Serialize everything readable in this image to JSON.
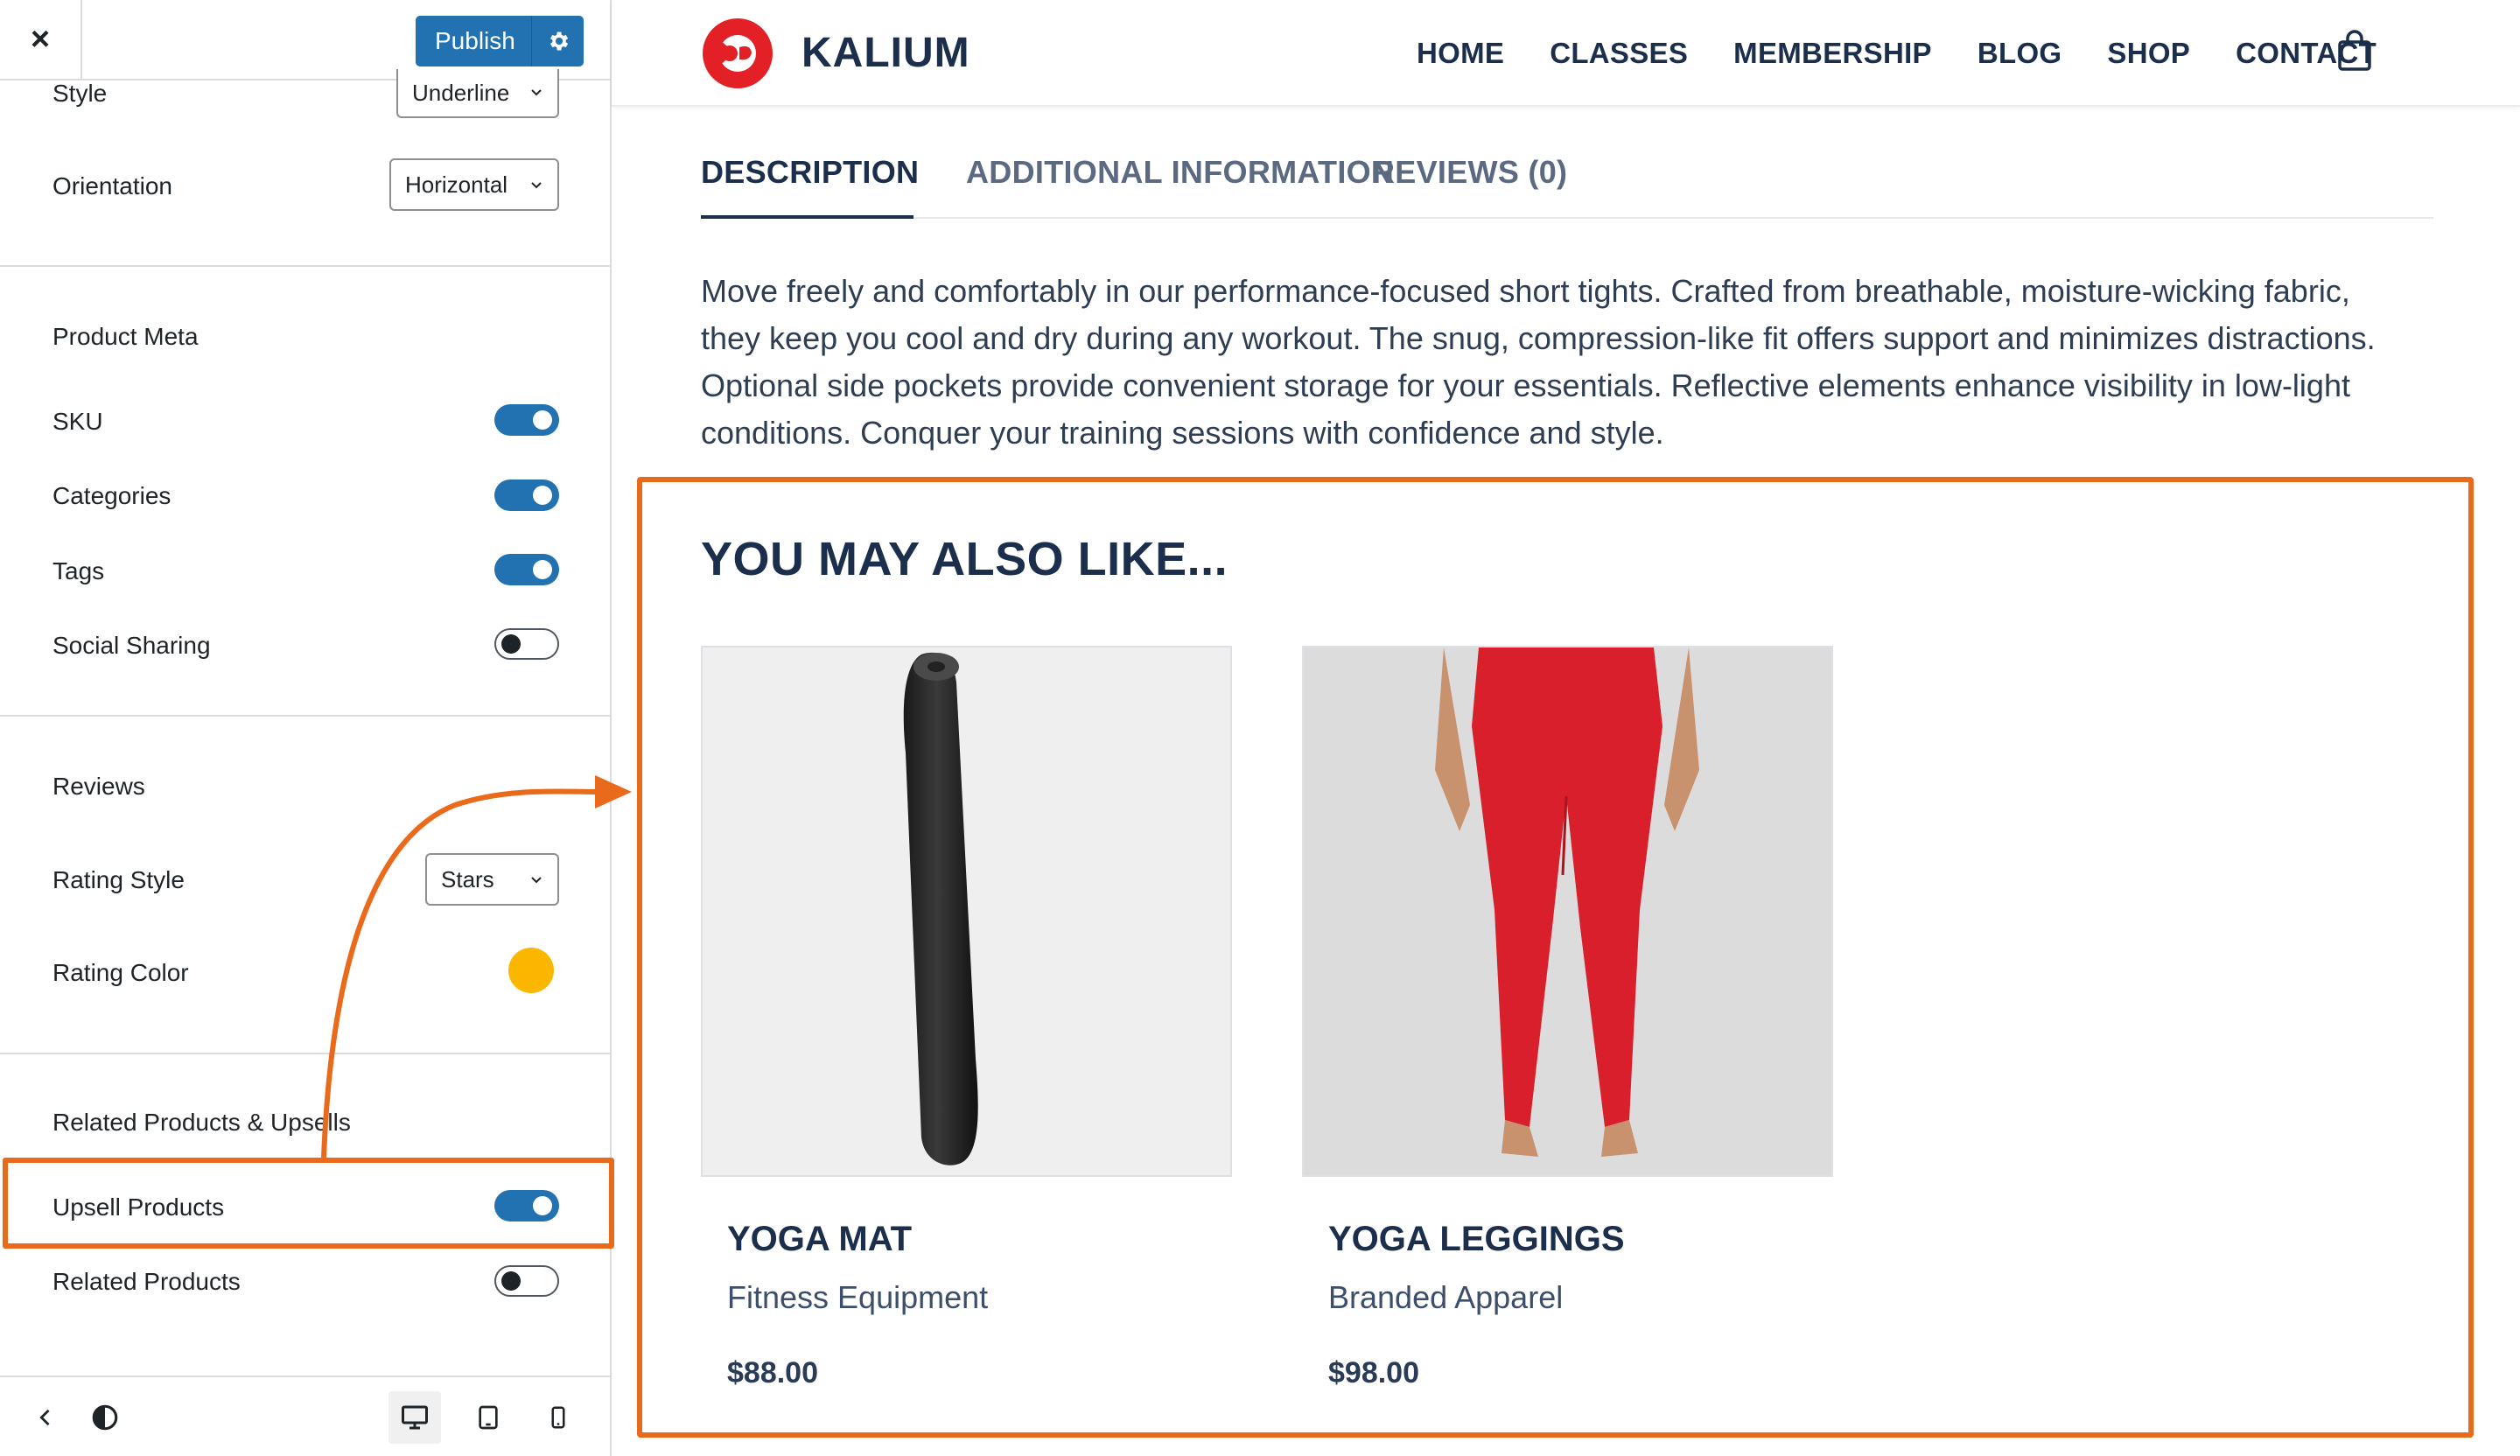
{
  "sidebar": {
    "close_symbol": "×",
    "publish_label": "Publish",
    "style": {
      "label": "Style",
      "value": "Underline"
    },
    "orientation": {
      "label": "Orientation",
      "value": "Horizontal"
    },
    "product_meta": {
      "title": "Product Meta",
      "toggles": [
        {
          "label": "SKU",
          "on": true
        },
        {
          "label": "Categories",
          "on": true
        },
        {
          "label": "Tags",
          "on": true
        },
        {
          "label": "Social Sharing",
          "on": false
        }
      ]
    },
    "reviews": {
      "title": "Reviews",
      "rating_style": {
        "label": "Rating Style",
        "value": "Stars"
      },
      "rating_color": {
        "label": "Rating Color",
        "color": "#fbb700"
      }
    },
    "related": {
      "title": "Related Products & Upsells",
      "toggles": [
        {
          "label": "Upsell Products",
          "on": true
        },
        {
          "label": "Related Products",
          "on": false
        }
      ]
    },
    "footer_icons": [
      "back-icon",
      "contrast-icon",
      "desktop-icon",
      "tablet-icon",
      "mobile-icon"
    ]
  },
  "site": {
    "brand": "KALIUM",
    "brand_color": "#e22026",
    "nav": [
      "HOME",
      "CLASSES",
      "MEMBERSHIP",
      "BLOG",
      "SHOP",
      "CONTACT"
    ],
    "tabs": [
      "DESCRIPTION",
      "ADDITIONAL INFORMATION",
      "REVIEWS (0)"
    ],
    "active_tab": "DESCRIPTION",
    "description": "Move freely and comfortably in our performance-focused short tights. Crafted from breathable, moisture-wicking fabric, they keep you cool and dry during any workout. The snug, compression-like fit offers support and minimizes distractions. Optional side pockets provide convenient storage for your essentials. Reflective elements enhance visibility in low-light conditions. Conquer your training sessions with confidence and style.",
    "upsell_heading": "YOU MAY ALSO LIKE...",
    "products": [
      {
        "name": "YOGA MAT",
        "category": "Fitness Equipment",
        "price": "$88.00"
      },
      {
        "name": "YOGA LEGGINGS",
        "category": "Branded Apparel",
        "price": "$98.00"
      }
    ]
  },
  "annotation_color": "#ea6a1c"
}
